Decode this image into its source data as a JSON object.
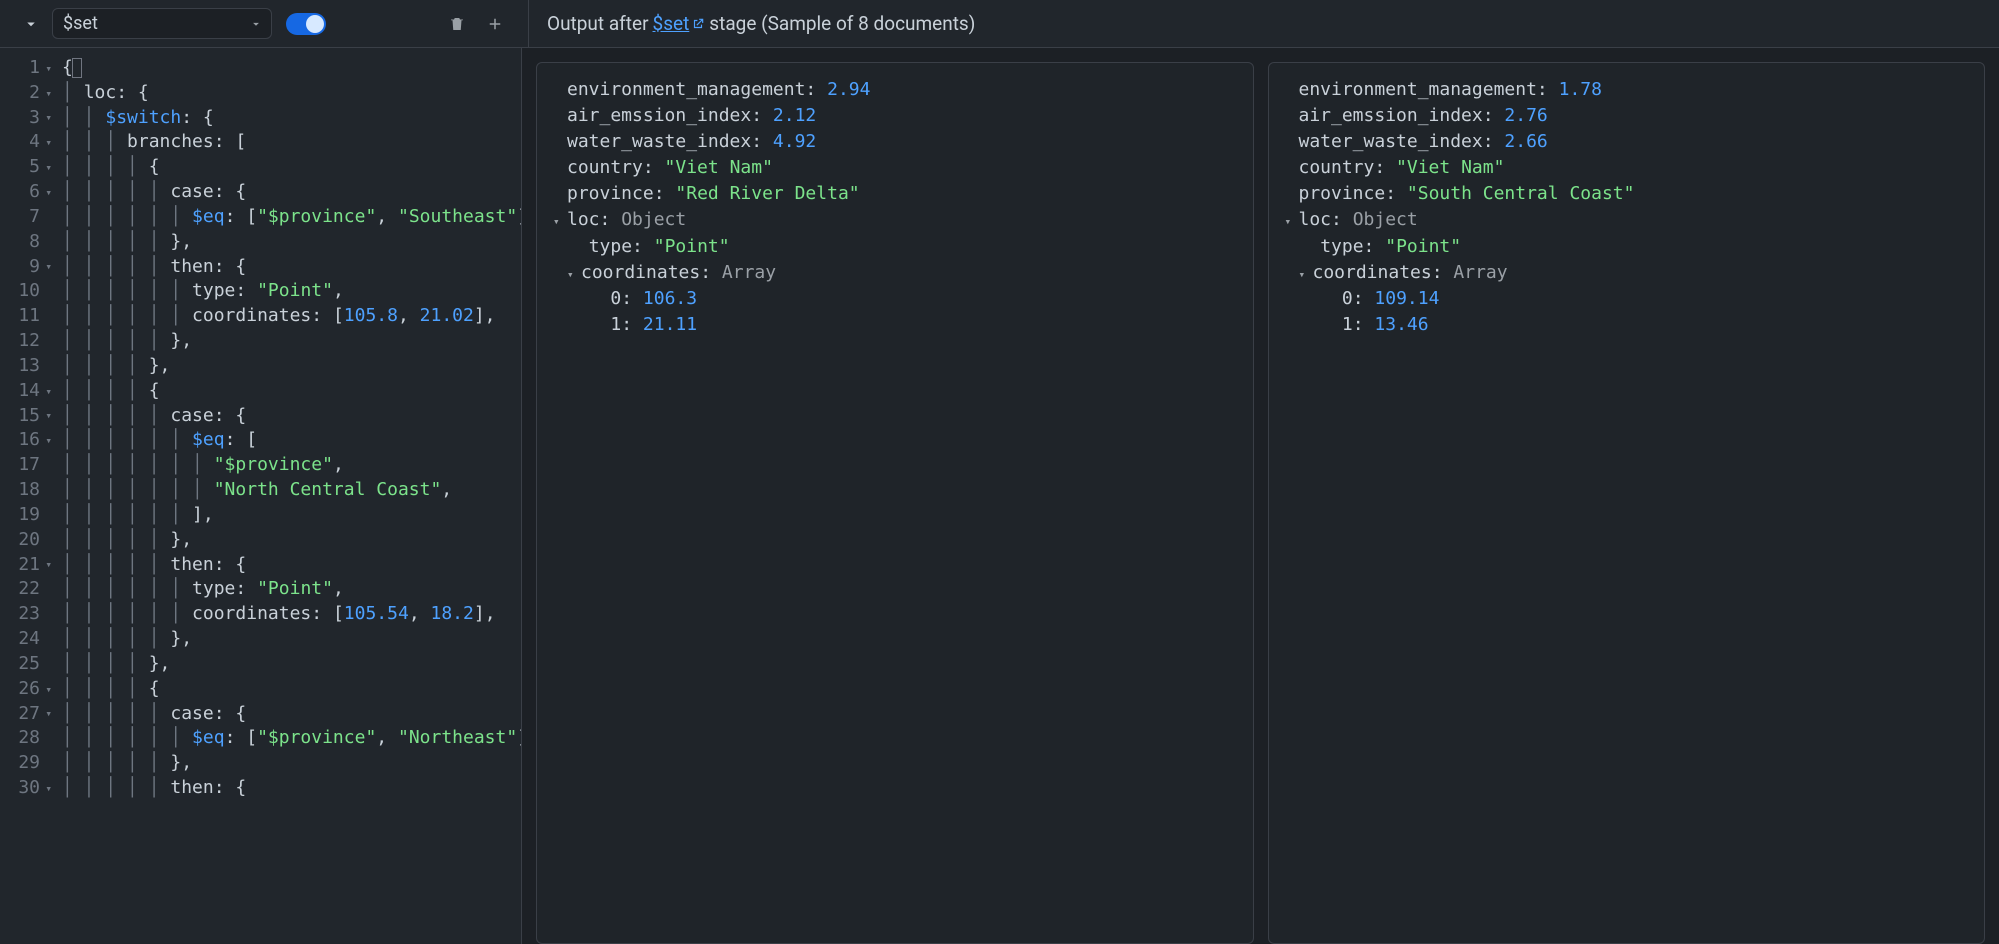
{
  "toolbar": {
    "stage_select": "$set",
    "output_prefix": "Output after ",
    "output_link": "$set",
    "output_suffix": " stage (Sample of 8 documents)"
  },
  "editor": {
    "lines": [
      {
        "n": 1,
        "fold": true,
        "tokens": [
          [
            "p",
            "{"
          ]
        ]
      },
      {
        "n": 2,
        "fold": true,
        "tokens": [
          [
            "g",
            "  "
          ],
          [
            "k",
            "loc"
          ],
          [
            "p",
            ": "
          ],
          [
            "p",
            "{"
          ]
        ]
      },
      {
        "n": 3,
        "fold": true,
        "tokens": [
          [
            "g",
            "    "
          ],
          [
            "kw",
            "$switch"
          ],
          [
            "p",
            ": "
          ],
          [
            "p",
            "{"
          ]
        ]
      },
      {
        "n": 4,
        "fold": true,
        "tokens": [
          [
            "g",
            "      "
          ],
          [
            "k",
            "branches"
          ],
          [
            "p",
            ": ["
          ]
        ]
      },
      {
        "n": 5,
        "fold": true,
        "tokens": [
          [
            "g",
            "        "
          ],
          [
            "p",
            "{"
          ]
        ]
      },
      {
        "n": 6,
        "fold": true,
        "tokens": [
          [
            "g",
            "          "
          ],
          [
            "k",
            "case"
          ],
          [
            "p",
            ": {"
          ]
        ]
      },
      {
        "n": 7,
        "fold": false,
        "tokens": [
          [
            "g",
            "            "
          ],
          [
            "kw",
            "$eq"
          ],
          [
            "p",
            ": ["
          ],
          [
            "s",
            "\"$province\""
          ],
          [
            "p",
            ", "
          ],
          [
            "s",
            "\"Southeast\""
          ],
          [
            "p",
            "]"
          ]
        ]
      },
      {
        "n": 8,
        "fold": false,
        "tokens": [
          [
            "g",
            "          "
          ],
          [
            "p",
            "},"
          ]
        ]
      },
      {
        "n": 9,
        "fold": true,
        "tokens": [
          [
            "g",
            "          "
          ],
          [
            "k",
            "then"
          ],
          [
            "p",
            ": {"
          ]
        ]
      },
      {
        "n": 10,
        "fold": false,
        "tokens": [
          [
            "g",
            "            "
          ],
          [
            "k",
            "type"
          ],
          [
            "p",
            ": "
          ],
          [
            "s",
            "\"Point\""
          ],
          [
            "p",
            ","
          ]
        ]
      },
      {
        "n": 11,
        "fold": false,
        "tokens": [
          [
            "g",
            "            "
          ],
          [
            "k",
            "coordinates"
          ],
          [
            "p",
            ": ["
          ],
          [
            "n",
            "105.8"
          ],
          [
            "p",
            ", "
          ],
          [
            "n",
            "21.02"
          ],
          [
            "p",
            "],"
          ]
        ]
      },
      {
        "n": 12,
        "fold": false,
        "tokens": [
          [
            "g",
            "          "
          ],
          [
            "p",
            "},"
          ]
        ]
      },
      {
        "n": 13,
        "fold": false,
        "tokens": [
          [
            "g",
            "        "
          ],
          [
            "p",
            "},"
          ]
        ]
      },
      {
        "n": 14,
        "fold": true,
        "tokens": [
          [
            "g",
            "        "
          ],
          [
            "p",
            "{"
          ]
        ]
      },
      {
        "n": 15,
        "fold": true,
        "tokens": [
          [
            "g",
            "          "
          ],
          [
            "k",
            "case"
          ],
          [
            "p",
            ": {"
          ]
        ]
      },
      {
        "n": 16,
        "fold": true,
        "tokens": [
          [
            "g",
            "            "
          ],
          [
            "kw",
            "$eq"
          ],
          [
            "p",
            ": ["
          ]
        ]
      },
      {
        "n": 17,
        "fold": false,
        "tokens": [
          [
            "g",
            "              "
          ],
          [
            "s",
            "\"$province\""
          ],
          [
            "p",
            ","
          ]
        ]
      },
      {
        "n": 18,
        "fold": false,
        "tokens": [
          [
            "g",
            "              "
          ],
          [
            "s",
            "\"North Central Coast\""
          ],
          [
            "p",
            ","
          ]
        ]
      },
      {
        "n": 19,
        "fold": false,
        "tokens": [
          [
            "g",
            "            "
          ],
          [
            "p",
            "],"
          ]
        ]
      },
      {
        "n": 20,
        "fold": false,
        "tokens": [
          [
            "g",
            "          "
          ],
          [
            "p",
            "},"
          ]
        ]
      },
      {
        "n": 21,
        "fold": true,
        "tokens": [
          [
            "g",
            "          "
          ],
          [
            "k",
            "then"
          ],
          [
            "p",
            ": {"
          ]
        ]
      },
      {
        "n": 22,
        "fold": false,
        "tokens": [
          [
            "g",
            "            "
          ],
          [
            "k",
            "type"
          ],
          [
            "p",
            ": "
          ],
          [
            "s",
            "\"Point\""
          ],
          [
            "p",
            ","
          ]
        ]
      },
      {
        "n": 23,
        "fold": false,
        "tokens": [
          [
            "g",
            "            "
          ],
          [
            "k",
            "coordinates"
          ],
          [
            "p",
            ": ["
          ],
          [
            "n",
            "105.54"
          ],
          [
            "p",
            ", "
          ],
          [
            "n",
            "18.2"
          ],
          [
            "p",
            "],"
          ]
        ]
      },
      {
        "n": 24,
        "fold": false,
        "tokens": [
          [
            "g",
            "          "
          ],
          [
            "p",
            "},"
          ]
        ]
      },
      {
        "n": 25,
        "fold": false,
        "tokens": [
          [
            "g",
            "        "
          ],
          [
            "p",
            "},"
          ]
        ]
      },
      {
        "n": 26,
        "fold": true,
        "tokens": [
          [
            "g",
            "        "
          ],
          [
            "p",
            "{"
          ]
        ]
      },
      {
        "n": 27,
        "fold": true,
        "tokens": [
          [
            "g",
            "          "
          ],
          [
            "k",
            "case"
          ],
          [
            "p",
            ": {"
          ]
        ]
      },
      {
        "n": 28,
        "fold": false,
        "tokens": [
          [
            "g",
            "            "
          ],
          [
            "kw",
            "$eq"
          ],
          [
            "p",
            ": ["
          ],
          [
            "s",
            "\"$province\""
          ],
          [
            "p",
            ", "
          ],
          [
            "s",
            "\"Northeast\""
          ],
          [
            "p",
            "]"
          ]
        ]
      },
      {
        "n": 29,
        "fold": false,
        "tokens": [
          [
            "g",
            "          "
          ],
          [
            "p",
            "},"
          ]
        ]
      },
      {
        "n": 30,
        "fold": true,
        "tokens": [
          [
            "g",
            "          "
          ],
          [
            "k",
            "then"
          ],
          [
            "p",
            ": {"
          ]
        ]
      }
    ]
  },
  "docs": [
    {
      "environment_management": "2.94",
      "air_emssion_index": "2.12",
      "water_waste_index": "4.92",
      "country": "\"Viet Nam\"",
      "province": "\"Red River Delta\"",
      "loc_type_label": "Object",
      "type": "\"Point\"",
      "coordinates_label": "Array",
      "c0": "106.3",
      "c1": "21.11"
    },
    {
      "environment_management": "1.78",
      "air_emssion_index": "2.76",
      "water_waste_index": "2.66",
      "country": "\"Viet Nam\"",
      "province": "\"South Central Coast\"",
      "loc_type_label": "Object",
      "type": "\"Point\"",
      "coordinates_label": "Array",
      "c0": "109.14",
      "c1": "13.46"
    }
  ],
  "labels": {
    "environment_management": "environment_management",
    "air_emssion_index": "air_emssion_index",
    "water_waste_index": "water_waste_index",
    "country": "country",
    "province": "province",
    "loc": "loc",
    "type": "type",
    "coordinates": "coordinates",
    "idx0": "0",
    "idx1": "1"
  }
}
